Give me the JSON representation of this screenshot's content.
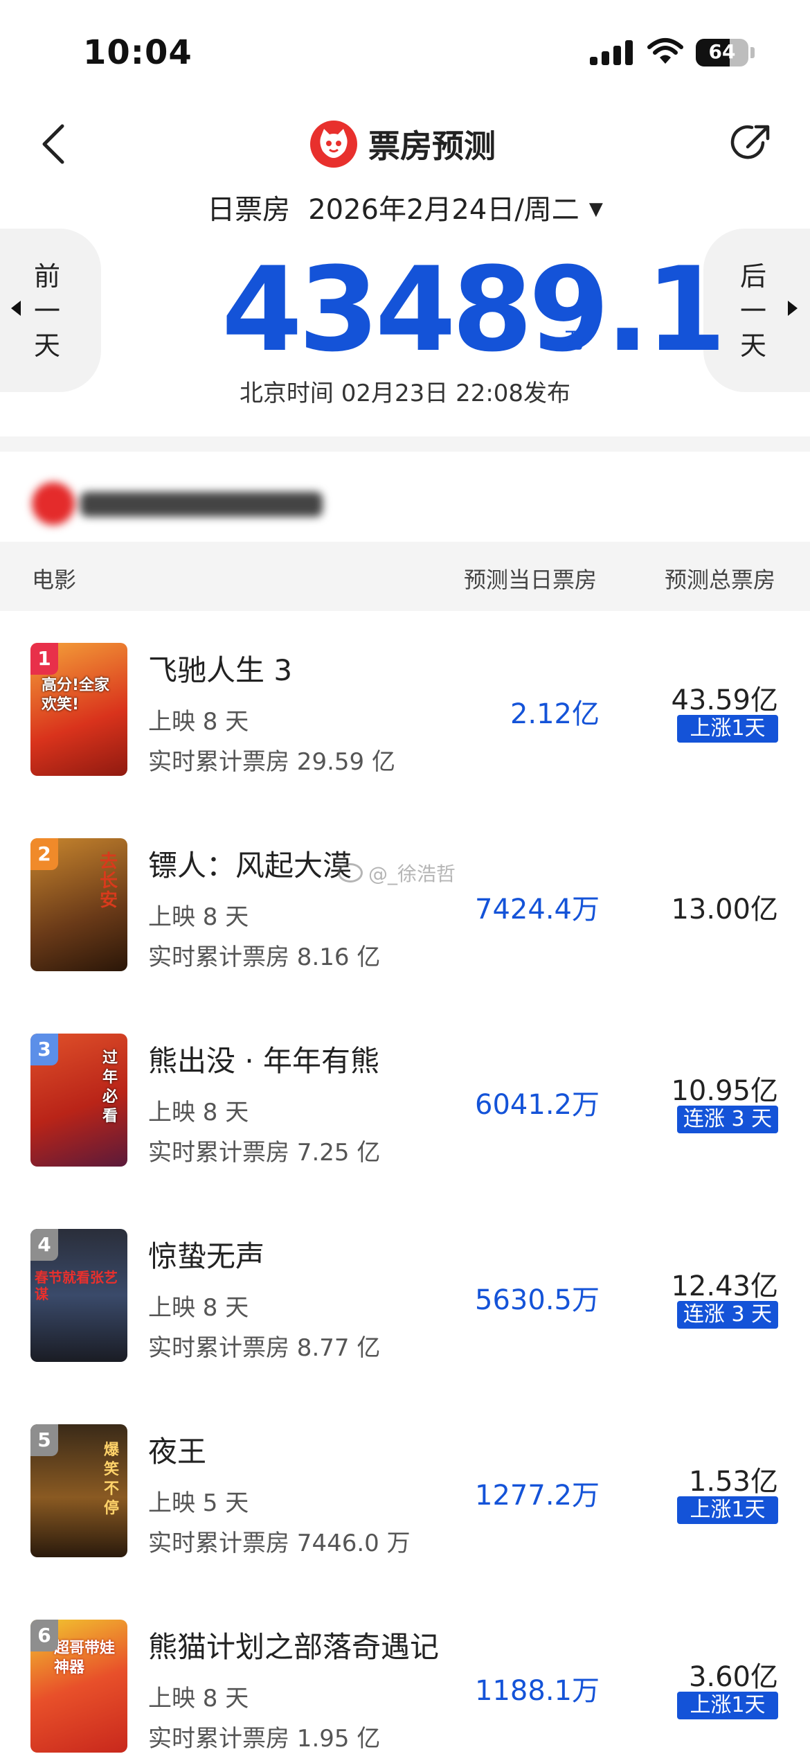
{
  "status_bar": {
    "time": "10:04",
    "battery": "64",
    "battery_level": 0.64
  },
  "header": {
    "title": "票房预测"
  },
  "date": {
    "label": "日票房",
    "value": "2026年2月24日/周二"
  },
  "nav": {
    "prev_label": [
      "前",
      "一",
      "天"
    ],
    "next_label": [
      "后",
      "一",
      "天"
    ]
  },
  "summary": {
    "value": "43489.1",
    "unit": "万",
    "publish_time": "北京时间  02月23日  22:08发布"
  },
  "columns": {
    "movie": "电影",
    "today": "预测当日票房",
    "total": "预测总票房"
  },
  "colors": {
    "accent": "#1453d8",
    "logo": "#e8302d",
    "rank1": "#e8304a",
    "rank2": "#f08a2a",
    "rank3": "#5c8fe8",
    "rank_other": "#8e8e8e"
  },
  "watermark": "@_徐浩哲",
  "movies": [
    {
      "rank": "1",
      "title": "飞驰人生 3",
      "days": "上映 8 天",
      "cumulative": "实时累计票房 29.59 亿",
      "today": "2.12亿",
      "total": "43.59亿",
      "trend": "上涨1天",
      "poster_text": "高分!全家欢笑!"
    },
    {
      "rank": "2",
      "title": "镖人：风起大漠",
      "days": "上映 8 天",
      "cumulative": "实时累计票房 8.16 亿",
      "today": "7424.4万",
      "total": "13.00亿",
      "trend": "",
      "poster_text": "去长安"
    },
    {
      "rank": "3",
      "title": "熊出没 · 年年有熊",
      "days": "上映 8 天",
      "cumulative": "实时累计票房 7.25 亿",
      "today": "6041.2万",
      "total": "10.95亿",
      "trend": "连涨 3 天",
      "poster_text": "过年必看"
    },
    {
      "rank": "4",
      "title": "惊蛰无声",
      "days": "上映 8 天",
      "cumulative": "实时累计票房 8.77 亿",
      "today": "5630.5万",
      "total": "12.43亿",
      "trend": "连涨 3 天",
      "poster_text": "春节就看张艺谋"
    },
    {
      "rank": "5",
      "title": "夜王",
      "days": "上映 5 天",
      "cumulative": "实时累计票房 7446.0 万",
      "today": "1277.2万",
      "total": "1.53亿",
      "trend": "上涨1天",
      "poster_text": "爆笑不停"
    },
    {
      "rank": "6",
      "title": "熊猫计划之部落奇遇记",
      "days": "上映 8 天",
      "cumulative": "实时累计票房 1.95 亿",
      "today": "1188.1万",
      "total": "3.60亿",
      "trend": "上涨1天",
      "poster_text": "超哥带娃神器"
    }
  ]
}
